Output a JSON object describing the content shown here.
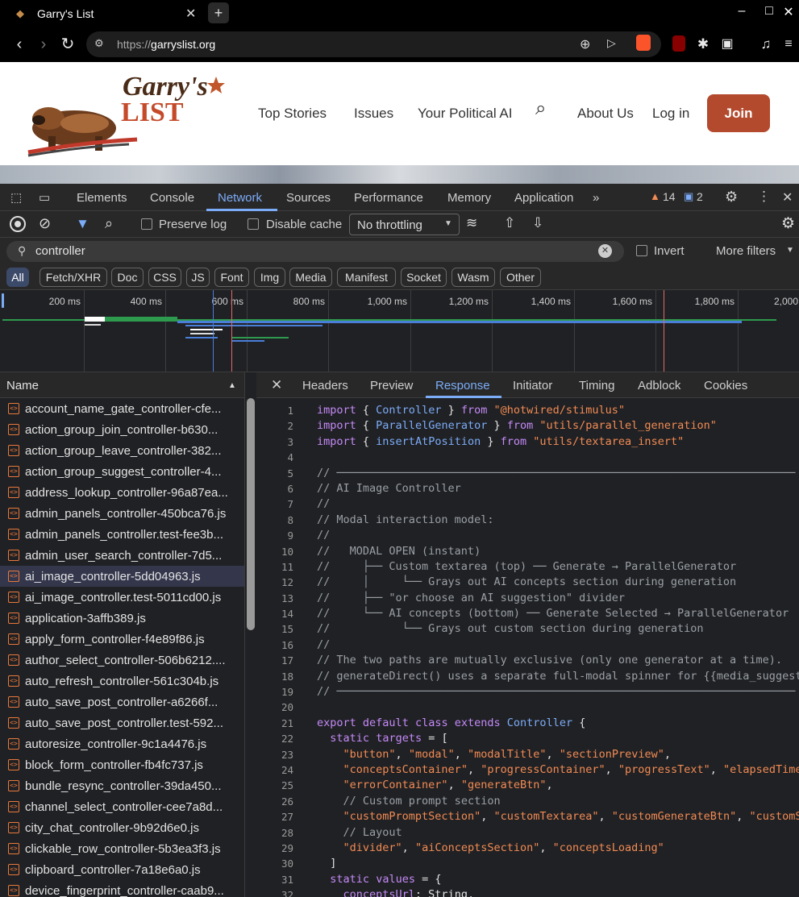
{
  "browser": {
    "tab_title": "Garry's List",
    "tab_close": "✕",
    "new_tab": "+",
    "url_scheme": "https://",
    "url_host": "garryslist.org"
  },
  "site": {
    "logo_line1": "Garry's",
    "logo_line2": "LIST",
    "nav": [
      "Top Stories",
      "Issues",
      "Your Political AI",
      "About Us",
      "Log in"
    ],
    "join_label": "Join"
  },
  "devtools": {
    "panels": [
      "Elements",
      "Console",
      "Network",
      "Sources",
      "Performance",
      "Memory",
      "Application"
    ],
    "active_panel": "Network",
    "warning_count": "14",
    "message_count": "2",
    "preserve_log": "Preserve log",
    "disable_cache": "Disable cache",
    "throttling": "No throttling",
    "filter_value": "controller",
    "invert_label": "Invert",
    "more_filters": "More filters",
    "types": [
      "All",
      "Fetch/XHR",
      "Doc",
      "CSS",
      "JS",
      "Font",
      "Img",
      "Media",
      "Manifest",
      "Socket",
      "Wasm",
      "Other"
    ],
    "timeline_ticks": [
      "200 ms",
      "400 ms",
      "600 ms",
      "800 ms",
      "1,000 ms",
      "1,200 ms",
      "1,400 ms",
      "1,600 ms",
      "1,800 ms",
      "2,000"
    ],
    "name_header": "Name",
    "files": [
      "account_name_gate_controller-cfe...",
      "action_group_join_controller-b630...",
      "action_group_leave_controller-382...",
      "action_group_suggest_controller-4...",
      "address_lookup_controller-96a87ea...",
      "admin_panels_controller-450bca76.js",
      "admin_panels_controller.test-fee3b...",
      "admin_user_search_controller-7d5...",
      "ai_image_controller-5dd04963.js",
      "ai_image_controller.test-5011cd00.js",
      "application-3affb389.js",
      "apply_form_controller-f4e89f86.js",
      "author_select_controller-506b6212....",
      "auto_refresh_controller-561c304b.js",
      "auto_save_post_controller-a6266f...",
      "auto_save_post_controller.test-592...",
      "autoresize_controller-9c1a4476.js",
      "block_form_controller-fb4fc737.js",
      "bundle_resync_controller-39da450...",
      "channel_select_controller-cee7a8d...",
      "city_chat_controller-9b92d6e0.js",
      "clickable_row_controller-5b3ea3f3.js",
      "clipboard_controller-7a18e6a0.js",
      "device_fingerprint_controller-caab9..."
    ],
    "selected_file": "ai_image_controller-5dd04963.js",
    "response_tabs": [
      "Headers",
      "Preview",
      "Response",
      "Initiator",
      "Timing",
      "Adblock",
      "Cookies"
    ],
    "active_response_tab": "Response",
    "code_lines": [
      "import { Controller } from \"@hotwired/stimulus\"",
      "import { ParallelGenerator } from \"utils/parallel_generation\"",
      "import { insertAtPosition } from \"utils/textarea_insert\"",
      "",
      "// ──────────────────────────────────────────────────────────────────────",
      "// AI Image Controller",
      "//",
      "// Modal interaction model:",
      "//",
      "//   MODAL OPEN (instant)",
      "//     ├── Custom textarea (top) ── Generate → ParallelGenerator",
      "//     │     └── Grays out AI concepts section during generation",
      "//     ├── \"or choose an AI suggestion\" divider",
      "//     └── AI concepts (bottom) ── Generate Selected → ParallelGenerator",
      "//           └── Grays out custom section during generation",
      "//",
      "// The two paths are mutually exclusive (only one generator at a time).",
      "// generateDirect() uses a separate full-modal spinner for {{media_suggestions}}",
      "// ──────────────────────────────────────────────────────────────────────",
      "",
      "export default class extends Controller {",
      "  static targets = [",
      "    \"button\", \"modal\", \"modalTitle\", \"sectionPreview\",",
      "    \"conceptsContainer\", \"progressContainer\", \"progressText\", \"elapsedTime\",",
      "    \"errorContainer\", \"generateBtn\",",
      "    // Custom prompt section",
      "    \"customPromptSection\", \"customTextarea\", \"customGenerateBtn\", \"customSpinner\",",
      "    // Layout",
      "    \"divider\", \"aiConceptsSection\", \"conceptsLoading\"",
      "  ]",
      "  static values = {",
      "    conceptsUrl: String,"
    ]
  }
}
